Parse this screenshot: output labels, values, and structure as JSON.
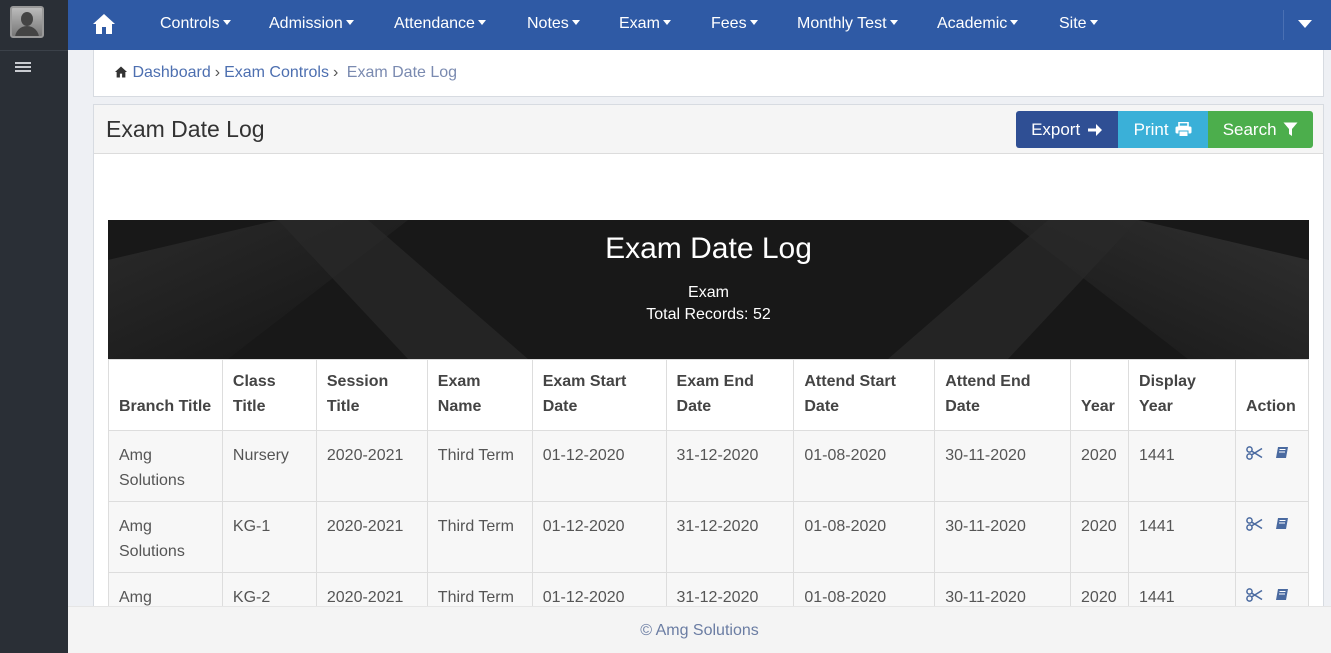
{
  "nav": {
    "items": [
      {
        "label": "Controls"
      },
      {
        "label": "Admission"
      },
      {
        "label": "Attendance"
      },
      {
        "label": "Notes"
      },
      {
        "label": "Exam"
      },
      {
        "label": "Fees"
      },
      {
        "label": "Monthly Test"
      },
      {
        "label": "Academic"
      },
      {
        "label": "Site"
      }
    ]
  },
  "breadcrumb": {
    "dashboard": "Dashboard",
    "exam_controls": "Exam Controls",
    "current": "Exam Date Log"
  },
  "panel": {
    "title": "Exam Date Log",
    "export_label": "Export",
    "print_label": "Print",
    "search_label": "Search"
  },
  "banner": {
    "title": "Exam Date Log",
    "subtitle": "Exam",
    "records": "Total Records: 52"
  },
  "table": {
    "headers": [
      "Branch Title",
      "Class Title",
      "Session Title",
      "Exam Name",
      "Exam Start Date",
      "Exam End Date",
      "Attend Start Date",
      "Attend End Date",
      "Year",
      "Display Year",
      "Action"
    ],
    "rows": [
      [
        "Amg Solutions",
        "Nursery",
        "2020-2021",
        "Third Term",
        "01-12-2020",
        "31-12-2020",
        "01-08-2020",
        "30-11-2020",
        "2020",
        "1441"
      ],
      [
        "Amg Solutions",
        "KG-1",
        "2020-2021",
        "Third Term",
        "01-12-2020",
        "31-12-2020",
        "01-08-2020",
        "30-11-2020",
        "2020",
        "1441"
      ],
      [
        "Amg",
        "KG-2",
        "2020-2021",
        "Third Term",
        "01-12-2020",
        "31-12-2020",
        "01-08-2020",
        "30-11-2020",
        "2020",
        "1441"
      ]
    ]
  },
  "footer": {
    "text": "© Amg Solutions"
  },
  "colors": {
    "nav": "#2f5aa5",
    "sidebar": "#2a2f36",
    "export": "#2f4f94",
    "print": "#3ab0d8",
    "search": "#4cae4c"
  }
}
